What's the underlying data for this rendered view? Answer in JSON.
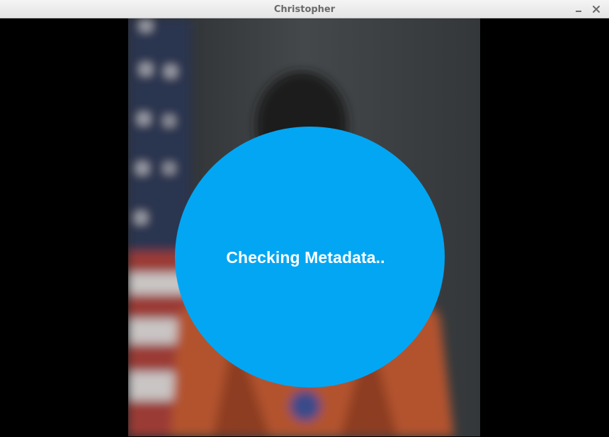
{
  "window": {
    "title": "Christopher",
    "controls": {
      "minimize_icon": "minimize-icon",
      "close_icon": "close-icon"
    }
  },
  "main": {
    "background_image": "blurred-astronaut-portrait",
    "status_text": "Checking Metadata.."
  },
  "colors": {
    "accent": "#03a6f3",
    "titlebar": "#ececec",
    "background": "#000000"
  }
}
